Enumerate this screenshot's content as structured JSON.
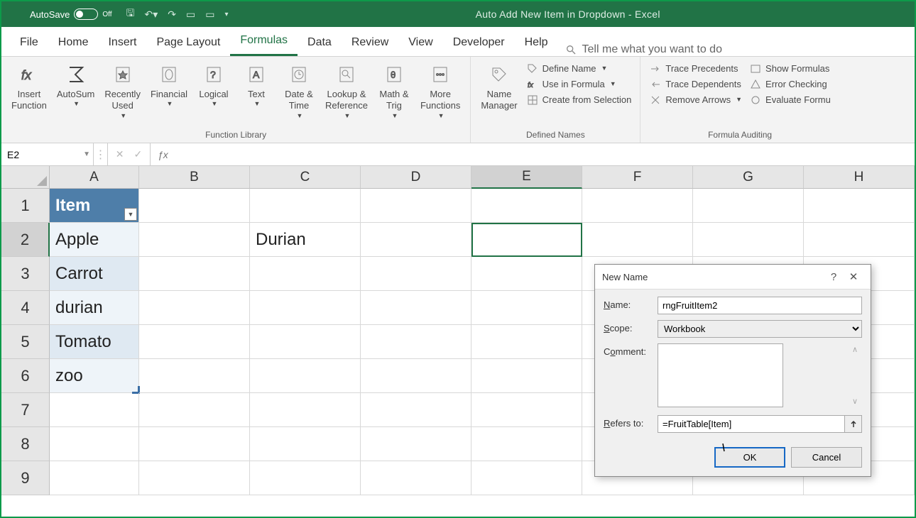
{
  "titlebar": {
    "autosave_label": "AutoSave",
    "autosave_state": "Off",
    "title": "Auto Add New Item in Dropdown  -  Excel"
  },
  "menu": {
    "tabs": [
      "File",
      "Home",
      "Insert",
      "Page Layout",
      "Formulas",
      "Data",
      "Review",
      "View",
      "Developer",
      "Help"
    ],
    "active": 4,
    "tell_me": "Tell me what you want to do"
  },
  "ribbon": {
    "insert_function": "Insert\nFunction",
    "autosum": "AutoSum",
    "recently_used": "Recently\nUsed",
    "financial": "Financial",
    "logical": "Logical",
    "text": "Text",
    "date_time": "Date &\nTime",
    "lookup_ref": "Lookup &\nReference",
    "math_trig": "Math &\nTrig",
    "more_fn": "More\nFunctions",
    "g1": "Function Library",
    "name_mgr": "Name\nManager",
    "define_name": "Define Name",
    "use_in_formula": "Use in Formula",
    "create_sel": "Create from Selection",
    "g2": "Defined Names",
    "trace_prec": "Trace Precedents",
    "trace_dep": "Trace Dependents",
    "remove_arr": "Remove Arrows",
    "show_form": "Show Formulas",
    "err_check": "Error Checking",
    "eval_form": "Evaluate Formu",
    "g3": "Formula Auditing"
  },
  "fbar": {
    "namebox": "E2",
    "formula": ""
  },
  "columns": [
    "A",
    "B",
    "C",
    "D",
    "E",
    "F",
    "G",
    "H"
  ],
  "rows": [
    "1",
    "2",
    "3",
    "4",
    "5",
    "6",
    "7",
    "8",
    "9"
  ],
  "sheet": {
    "a1": "Item",
    "a2": "Apple",
    "a3": "Carrot",
    "a4": "durian",
    "a5": "Tomato",
    "a6": "zoo",
    "c2": "Durian"
  },
  "dialog": {
    "title": "New Name",
    "name_label": "Name:",
    "name_value": "rngFruitItem2",
    "scope_label": "Scope:",
    "scope_value": "Workbook",
    "comment_label": "Comment:",
    "comment_value": "",
    "refers_label": "Refers to:",
    "refers_value": "=FruitTable[Item]",
    "ok": "OK",
    "cancel": "Cancel"
  }
}
